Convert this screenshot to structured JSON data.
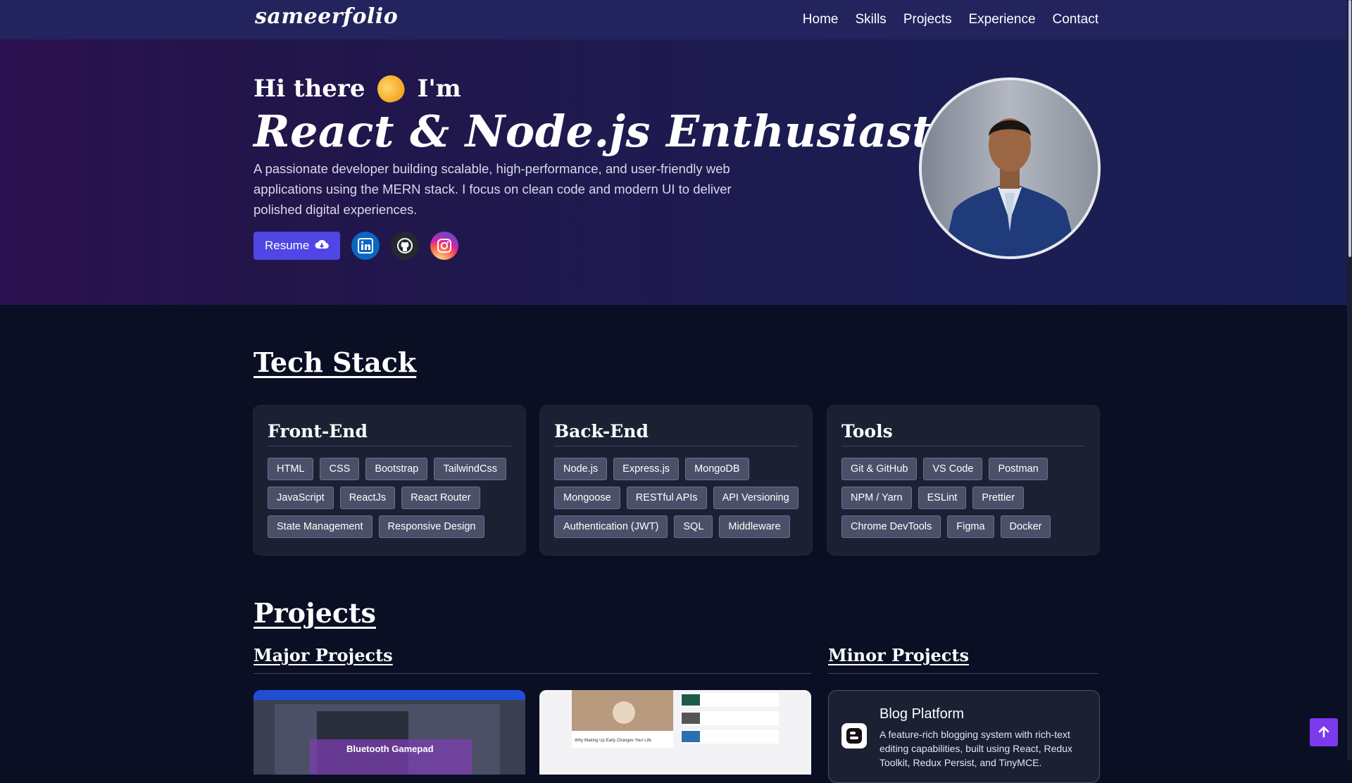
{
  "nav": {
    "brand": "sameerfolio",
    "links": [
      "Home",
      "Skills",
      "Projects",
      "Experience",
      "Contact"
    ]
  },
  "hero": {
    "greeting": "Hi there",
    "greeting_suffix": "I'm",
    "title": "React & Node.js Enthusiast",
    "description": "A passionate developer building scalable, high-performance, and user-friendly web applications using the MERN stack. I focus on clean code and modern UI to deliver polished digital experiences.",
    "resume_label": "Resume",
    "socials": [
      "linkedin-icon",
      "github-icon",
      "instagram-icon"
    ]
  },
  "tech_stack": {
    "title": "Tech Stack",
    "groups": [
      {
        "title": "Front-End",
        "items": [
          "HTML",
          "CSS",
          "Bootstrap",
          "TailwindCss",
          "JavaScript",
          "ReactJs",
          "React Router",
          "State Management",
          "Responsive Design"
        ]
      },
      {
        "title": "Back-End",
        "items": [
          "Node.js",
          "Express.js",
          "MongoDB",
          "Mongoose",
          "RESTful APIs",
          "API Versioning",
          "Authentication (JWT)",
          "SQL",
          "Middleware"
        ]
      },
      {
        "title": "Tools",
        "items": [
          "Git & GitHub",
          "VS Code",
          "Postman",
          "NPM / Yarn",
          "ESLint",
          "Prettier",
          "Chrome DevTools",
          "Figma",
          "Docker"
        ]
      }
    ]
  },
  "projects": {
    "title": "Projects",
    "major_title": "Major Projects",
    "minor_title": "Minor Projects",
    "major_preview_1_caption": "Bluetooth Gamepad",
    "major_preview_2_caption": "Why Waking Up Early Changes Your Life",
    "minor": {
      "title": "Blog Platform",
      "description": "A feature-rich blogging system with rich-text editing capabilities, built using React, Redux Toolkit, Redux Persist, and TinyMCE."
    }
  },
  "colors": {
    "accent": "#4f46e5",
    "scroll_top": "#7c3aed",
    "background": "#0a0f24",
    "card": "#1b2033"
  }
}
